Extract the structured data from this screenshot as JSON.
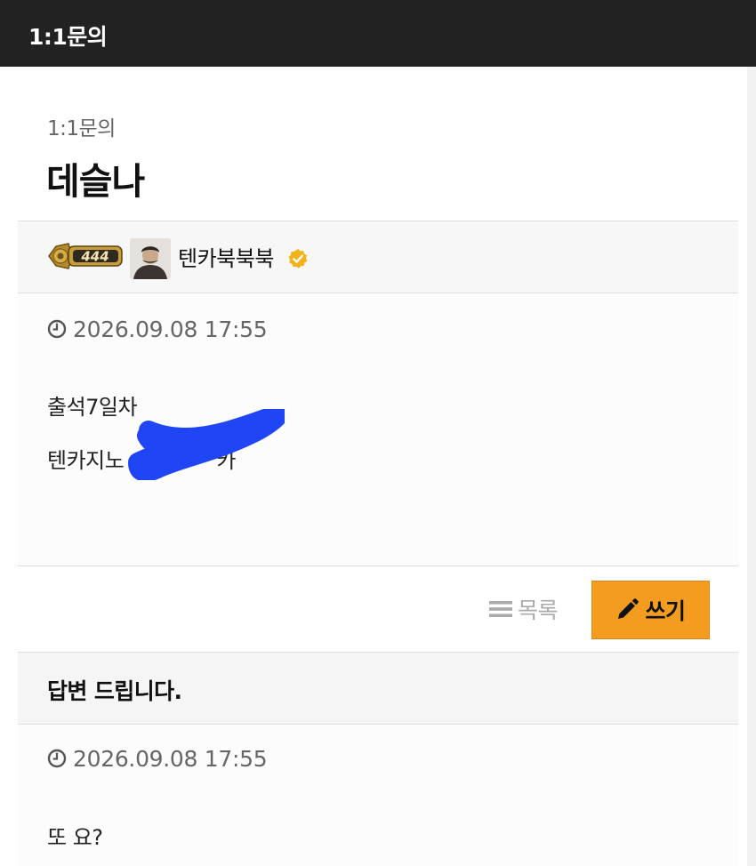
{
  "topbar": {
    "title": "1:1문의"
  },
  "post": {
    "board_label": "1:1문의",
    "title": "데슬나",
    "author": {
      "level_text": "444",
      "name": "텐카북북북",
      "avatar_icon": "avatar-photo",
      "verified_icon": "verified-badge-icon"
    },
    "date": "2026.09.08 17:55",
    "body_lines": [
      "출석7일차",
      "텐카지노",
      "카"
    ]
  },
  "actions": {
    "list_label": "목록",
    "write_label": "쓰기"
  },
  "answer": {
    "title": "답변 드립니다.",
    "date": "2026.09.08 17:55",
    "text": "또 요?"
  },
  "colors": {
    "topbar_bg": "#222222",
    "write_button_bg": "#f39c1f",
    "verified_badge": "#f2b21a",
    "redaction_scribble": "#1f45f5"
  }
}
